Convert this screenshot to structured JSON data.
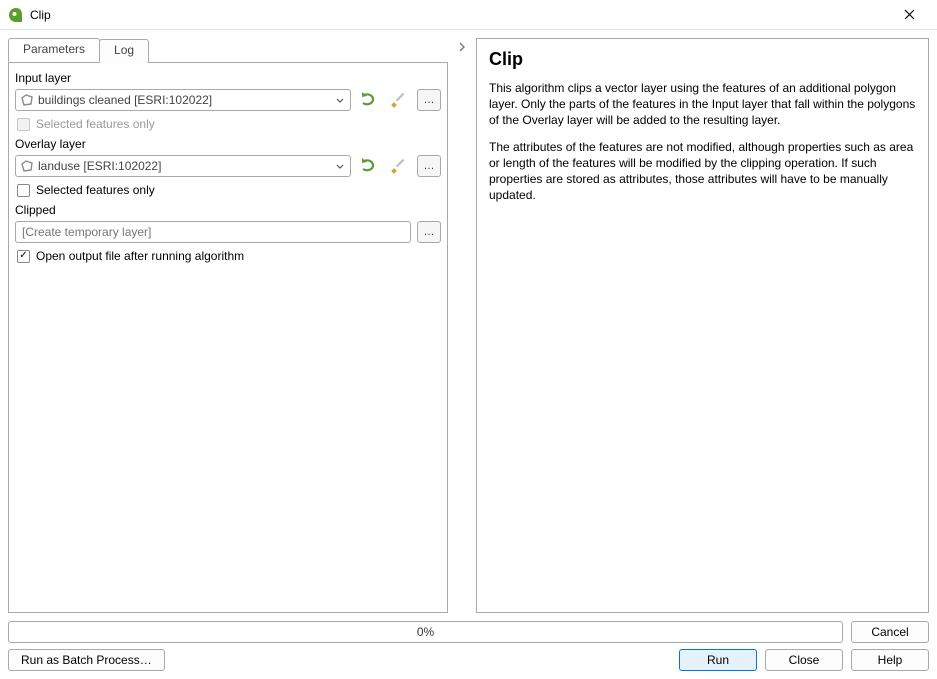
{
  "window": {
    "title": "Clip"
  },
  "tabs": {
    "parameters": "Parameters",
    "log": "Log"
  },
  "params": {
    "input_layer_label": "Input layer",
    "input_layer_value": "buildings cleaned [ESRI:102022]",
    "input_selected_only": "Selected features only",
    "overlay_layer_label": "Overlay layer",
    "overlay_layer_value": "landuse [ESRI:102022]",
    "overlay_selected_only": "Selected features only",
    "clipped_label": "Clipped",
    "clipped_placeholder": "[Create temporary layer]",
    "open_output": "Open output file after running algorithm"
  },
  "help": {
    "title": "Clip",
    "p1": "This algorithm clips a vector layer using the features of an additional polygon layer. Only the parts of the features in the Input layer that fall within the polygons of the Overlay layer will be added to the resulting layer.",
    "p2": "The attributes of the features are not modified, although properties such as area or length of the features will be modified by the clipping operation. If such properties are stored as attributes, those attributes will have to be manually updated."
  },
  "progress": "0%",
  "buttons": {
    "cancel": "Cancel",
    "batch": "Run as Batch Process…",
    "run": "Run",
    "close": "Close",
    "help": "Help"
  }
}
